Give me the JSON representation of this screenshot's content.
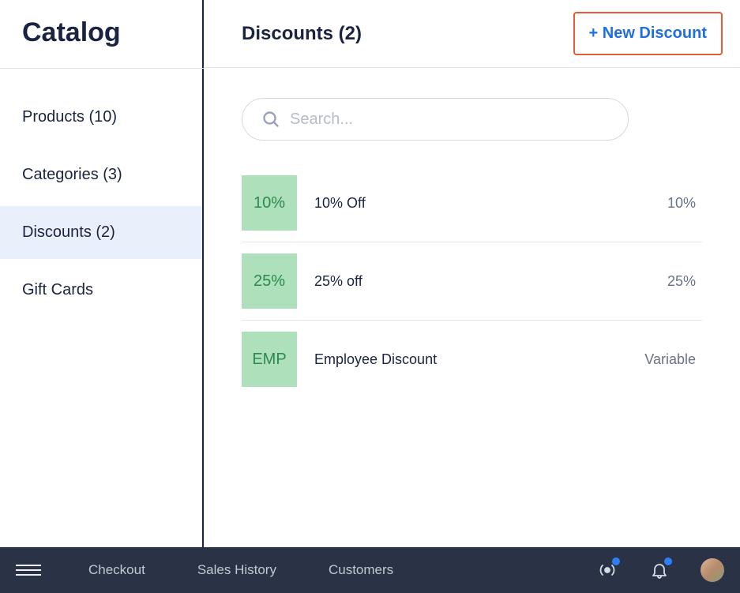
{
  "sidebar": {
    "title": "Catalog",
    "items": [
      {
        "label": "Products (10)"
      },
      {
        "label": "Categories (3)"
      },
      {
        "label": "Discounts (2)"
      },
      {
        "label": "Gift Cards"
      }
    ]
  },
  "header": {
    "title": "Discounts (2)",
    "new_button": "+ New Discount"
  },
  "search": {
    "placeholder": "Search..."
  },
  "discounts": [
    {
      "badge": "10%",
      "name": "10% Off",
      "value": "10%"
    },
    {
      "badge": "25%",
      "name": "25% off",
      "value": "25%"
    },
    {
      "badge": "EMP",
      "name": "Employee Discount",
      "value": "Variable"
    }
  ],
  "footer": {
    "links": [
      "Checkout",
      "Sales History",
      "Customers"
    ]
  }
}
